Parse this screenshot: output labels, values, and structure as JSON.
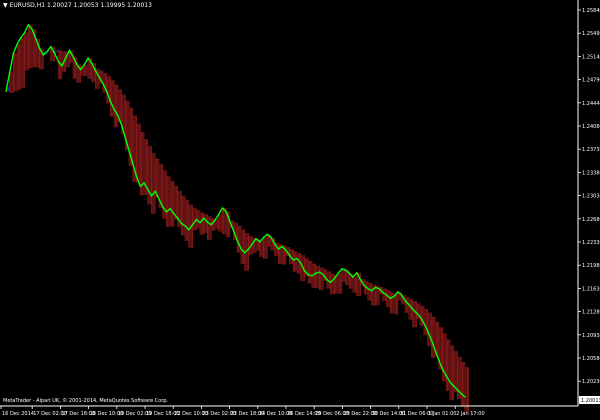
{
  "window": {
    "symbol_info": "EURUSD,H1  1.20027 1.20053 1.19995 1.20013",
    "copyright": "MetaTrader - Alpari UK, © 2001-2014, MetaQuotes Software Corp."
  },
  "colors": {
    "background": "#000000",
    "close_line": "#00ff00",
    "histogram_bear": "#8b1a1a",
    "histogram_bull": "#1a237e",
    "axis": "#ffffff"
  },
  "price_axis": {
    "labels": [
      "1.25840",
      "1.25490",
      "1.25140",
      "1.24790",
      "1.24440",
      "1.24080",
      "1.23730",
      "1.23380",
      "1.23030",
      "1.22680",
      "1.22330",
      "1.21980",
      "1.21630",
      "1.21280",
      "1.20930",
      "1.20580",
      "1.20230"
    ],
    "last_price": "1.20013"
  },
  "time_axis": {
    "labels": [
      "16 Dec 2014",
      "17 Dec 02:00",
      "17 Dec 18:00",
      "18 Dec 10:00",
      "19 Dec 02:00",
      "19 Dec 18:00",
      "22 Dec 10:00",
      "23 Dec 02:00",
      "23 Dec 18:00",
      "24 Dec 10:00",
      "26 Dec 14:00",
      "29 Dec 06:00",
      "29 Dec 22:00",
      "30 Dec 14:00",
      "31 Dec 06:00",
      "1 Jan 01:00",
      "2 Jan 17:00"
    ]
  },
  "chart_data": {
    "type": "line",
    "title": "EURUSD,H1",
    "xlabel": "",
    "ylabel": "",
    "ylim": [
      1.199,
      1.2602
    ],
    "series": [
      {
        "values": [
          1.2478,
          1.2508,
          1.2538,
          1.2552,
          1.2562,
          1.257,
          1.2582,
          1.2575,
          1.256,
          1.2545,
          1.2535,
          1.254,
          1.2548,
          1.2538,
          1.2525,
          1.2518,
          1.253,
          1.2542,
          1.2532,
          1.252,
          1.2512,
          1.252,
          1.253,
          1.2522,
          1.251,
          1.25,
          1.249,
          1.2478,
          1.2462,
          1.245,
          1.244,
          1.2425,
          1.2405,
          1.2385,
          1.2365,
          1.2345,
          1.233,
          1.2335,
          1.2325,
          1.2315,
          1.2322,
          1.231,
          1.2298,
          1.229,
          1.2295,
          1.2287,
          1.228,
          1.2272,
          1.2268,
          1.2262,
          1.227,
          1.2278,
          1.2273,
          1.228,
          1.2274,
          1.227,
          1.2277,
          1.2286,
          1.2296,
          1.229,
          1.2275,
          1.226,
          1.2245,
          1.2232,
          1.2226,
          1.2232,
          1.224,
          1.2248,
          1.2243,
          1.225,
          1.2255,
          1.225,
          1.224,
          1.2232,
          1.2236,
          1.223,
          1.2222,
          1.2215,
          1.2217,
          1.221,
          1.2198,
          1.2192,
          1.219,
          1.2194,
          1.2196,
          1.2192,
          1.2184,
          1.218,
          1.2186,
          1.2194,
          1.2201,
          1.2199,
          1.2194,
          1.2188,
          1.2195,
          1.2184,
          1.2175,
          1.217,
          1.2167,
          1.2172,
          1.217,
          1.2164,
          1.216,
          1.2155,
          1.2158,
          1.2165,
          1.216,
          1.2151,
          1.2145,
          1.2138,
          1.2132,
          1.2126,
          1.2116,
          1.2104,
          1.209,
          1.2074,
          1.2058,
          1.2044,
          1.2034,
          1.2024,
          1.2018,
          1.2012,
          1.2006,
          1.2001
        ]
      }
    ]
  }
}
